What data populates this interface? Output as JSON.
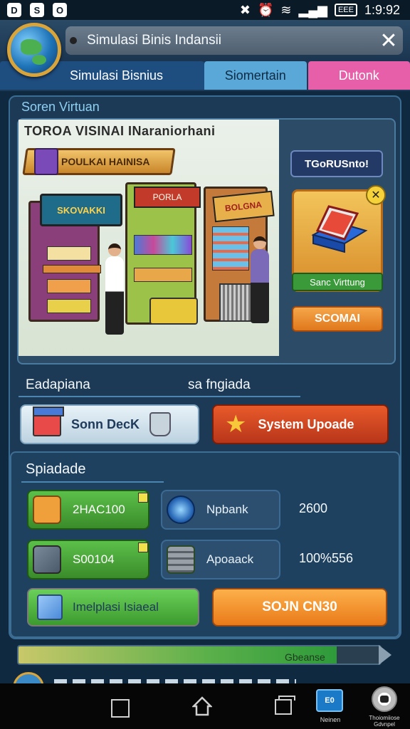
{
  "status_bar": {
    "time": "1:9:92",
    "battery": "EEE",
    "left_icons": [
      "D",
      "S",
      "O"
    ]
  },
  "header": {
    "search_text": "Simulasi Binis  Indansii",
    "close_glyph": "✕"
  },
  "tabs": [
    {
      "label": "Simulasi Bisnius"
    },
    {
      "label": "Siomertain"
    },
    {
      "label": "Dutonk"
    }
  ],
  "store_section": {
    "title": "Soren Virtuan",
    "scene_title": "TOROA VISINAI INaraniorhani",
    "banner": "POULKAI HAINISA",
    "stall_sign_1": "SKOVAKKI",
    "stall_sign_2": "PORLA",
    "stall_sign_3": "BOLGNA",
    "card_badge": "TGoRUSnto!",
    "card_close": "✕",
    "card_label": "Sanc Virttung",
    "social_button": "SCOMAI"
  },
  "info_row": {
    "left": "Eadapiana",
    "right": "sa fngiada"
  },
  "actions": {
    "deck_button": "Sonn DecK",
    "update_button": "System Upoade"
  },
  "stats_section": {
    "title": "Spiadade",
    "tiles": [
      {
        "label": "2HAC100",
        "value": "2600"
      },
      {
        "label": "Npbank",
        "value": ""
      },
      {
        "label": "S00104",
        "value": "100%556"
      },
      {
        "label": "Apoaack",
        "value": ""
      }
    ],
    "implasi_button": "Imelplasi Isiaeal",
    "sojn_button": "SOJN CN30"
  },
  "progress": {
    "label": "Gbeanse",
    "fraction": 0.88
  },
  "navbar": {
    "app_icon_text": "E0",
    "app_label": "Neinen",
    "avatar_label": "Thoiomiiose Gdvnpel"
  },
  "colors": {
    "background": "#0f2a40",
    "accent_green": "#3a8c2a",
    "accent_orange": "#ea7a1a",
    "accent_red": "#b8361a",
    "tab_pink": "#e65fa8",
    "tab_blue": "#5aa8d8"
  }
}
